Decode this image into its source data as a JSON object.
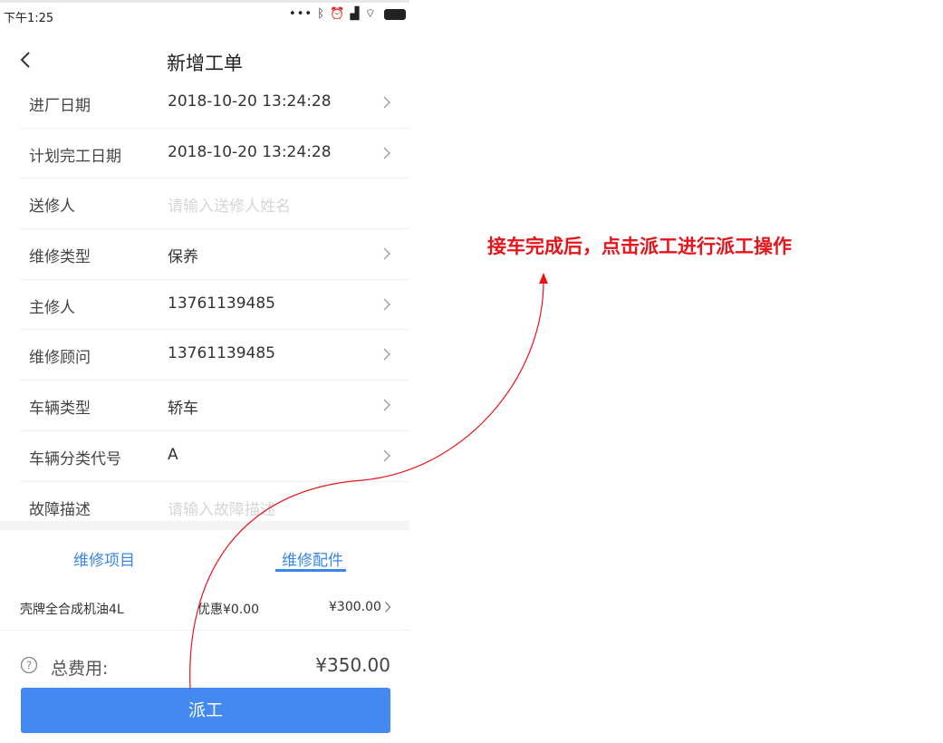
{
  "status_bar": {
    "time": "下午1:25",
    "icons": [
      "more-dots-icon",
      "bluetooth-icon",
      "alarm-icon",
      "signal-icon",
      "wifi-icon",
      "battery-icon"
    ]
  },
  "nav": {
    "title": "新增工单",
    "back_icon": "back-chevron-icon"
  },
  "form": {
    "rows": [
      {
        "label": "进厂日期",
        "value": "2018-10-20 13:24:28",
        "placeholder": "",
        "has_chevron": true
      },
      {
        "label": "计划完工日期",
        "value": "2018-10-20 13:24:28",
        "placeholder": "",
        "has_chevron": true
      },
      {
        "label": "送修人",
        "value": "",
        "placeholder": "请输入送修人姓名",
        "has_chevron": false
      },
      {
        "label": "维修类型",
        "value": "保养",
        "placeholder": "",
        "has_chevron": true
      },
      {
        "label": "主修人",
        "value": "13761139485",
        "placeholder": "",
        "has_chevron": true
      },
      {
        "label": "维修顾问",
        "value": "13761139485",
        "placeholder": "",
        "has_chevron": true
      },
      {
        "label": "车辆类型",
        "value": "轿车",
        "placeholder": "",
        "has_chevron": true
      },
      {
        "label": "车辆分类代号",
        "value": "A",
        "placeholder": "",
        "has_chevron": true
      },
      {
        "label": "故障描述",
        "value": "",
        "placeholder": "请输入故障描述",
        "has_chevron": false
      }
    ]
  },
  "tabs": {
    "items": [
      "维修项目",
      "维修配件"
    ],
    "active_index": 1
  },
  "parts": [
    {
      "name": "壳牌全合成机油4L",
      "discount": "优惠¥0.00",
      "price": "¥300.00"
    }
  ],
  "total": {
    "label": "总费用:",
    "amount": "¥350.00"
  },
  "actions": {
    "dispatch_label": "派工"
  },
  "annotation": {
    "text": "接车完成后，点击派工进行派工操作"
  },
  "colors": {
    "accent": "#4289f0",
    "tab_text": "#3a86e6",
    "annotation": "#e8141b",
    "placeholder": "#d6d6d6"
  }
}
